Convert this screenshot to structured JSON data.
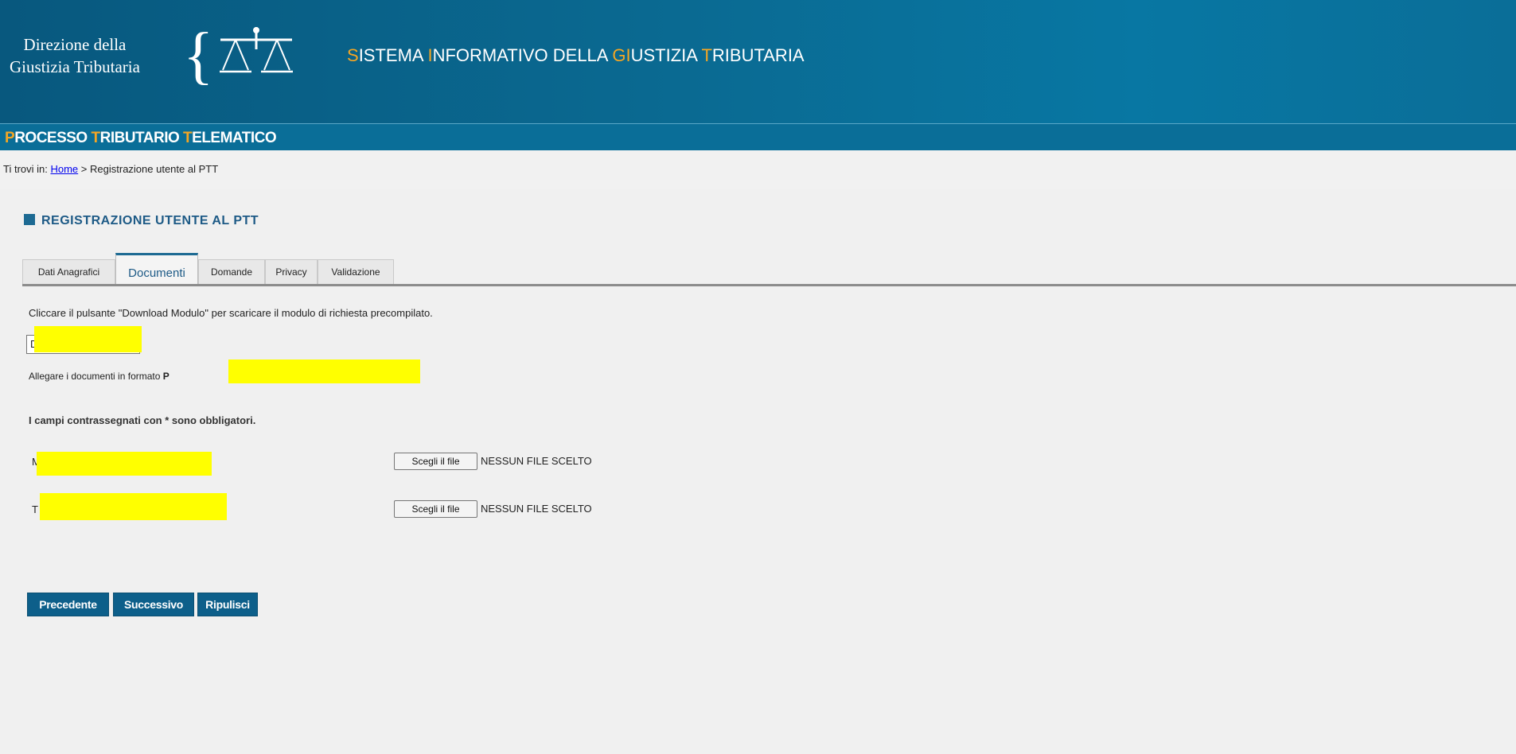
{
  "header": {
    "logo_line1": "Direzione della",
    "logo_line2": "Giustizia Tributaria",
    "site_title": {
      "parts": [
        {
          "hl": "S",
          "rest": "ISTEMA "
        },
        {
          "hl": "I",
          "rest": "NFORMATIVO DELLA "
        },
        {
          "hl": "GI",
          "rest": "USTIZIA "
        },
        {
          "hl": "T",
          "rest": "RIBUTARIA"
        }
      ]
    },
    "subtitle": {
      "parts": [
        {
          "hl": "P",
          "rest": "ROCESSO "
        },
        {
          "hl": "T",
          "rest": "RIBUTARIO "
        },
        {
          "hl": "T",
          "rest": "ELEMATICO"
        }
      ]
    },
    "colors": {
      "bar": "#0a6e98",
      "accent": "#f5a623"
    }
  },
  "breadcrumb": {
    "prefix": "Ti trovi in:",
    "home": "Home",
    "separator": ">",
    "current": "Registrazione utente al PTT"
  },
  "page": {
    "heading": "REGISTRAZIONE UTENTE AL PTT",
    "tabs": [
      {
        "label": "Dati Anagrafici"
      },
      {
        "label": "Documenti",
        "active": true
      },
      {
        "label": "Domande"
      },
      {
        "label": "Privacy"
      },
      {
        "label": "Validazione"
      }
    ],
    "info_text": "Cliccare il pulsante \"Download Modulo\" per scaricare il modulo di richiesta precompilato.",
    "download_button": "D",
    "attach_prefix": "Allegare i documenti in formato",
    "attach_bold": "P",
    "required_note": "I campi contrassegnati con * sono obbligatori.",
    "files": [
      {
        "label": "M",
        "button": "Scegli il file",
        "status": "NESSUN FILE SCELTO"
      },
      {
        "label": "T",
        "button": "Scegli il file",
        "status": "NESSUN FILE SCELTO"
      }
    ],
    "actions": {
      "prev": "Precedente",
      "next": "Successivo",
      "reset": "Ripulisci"
    }
  }
}
